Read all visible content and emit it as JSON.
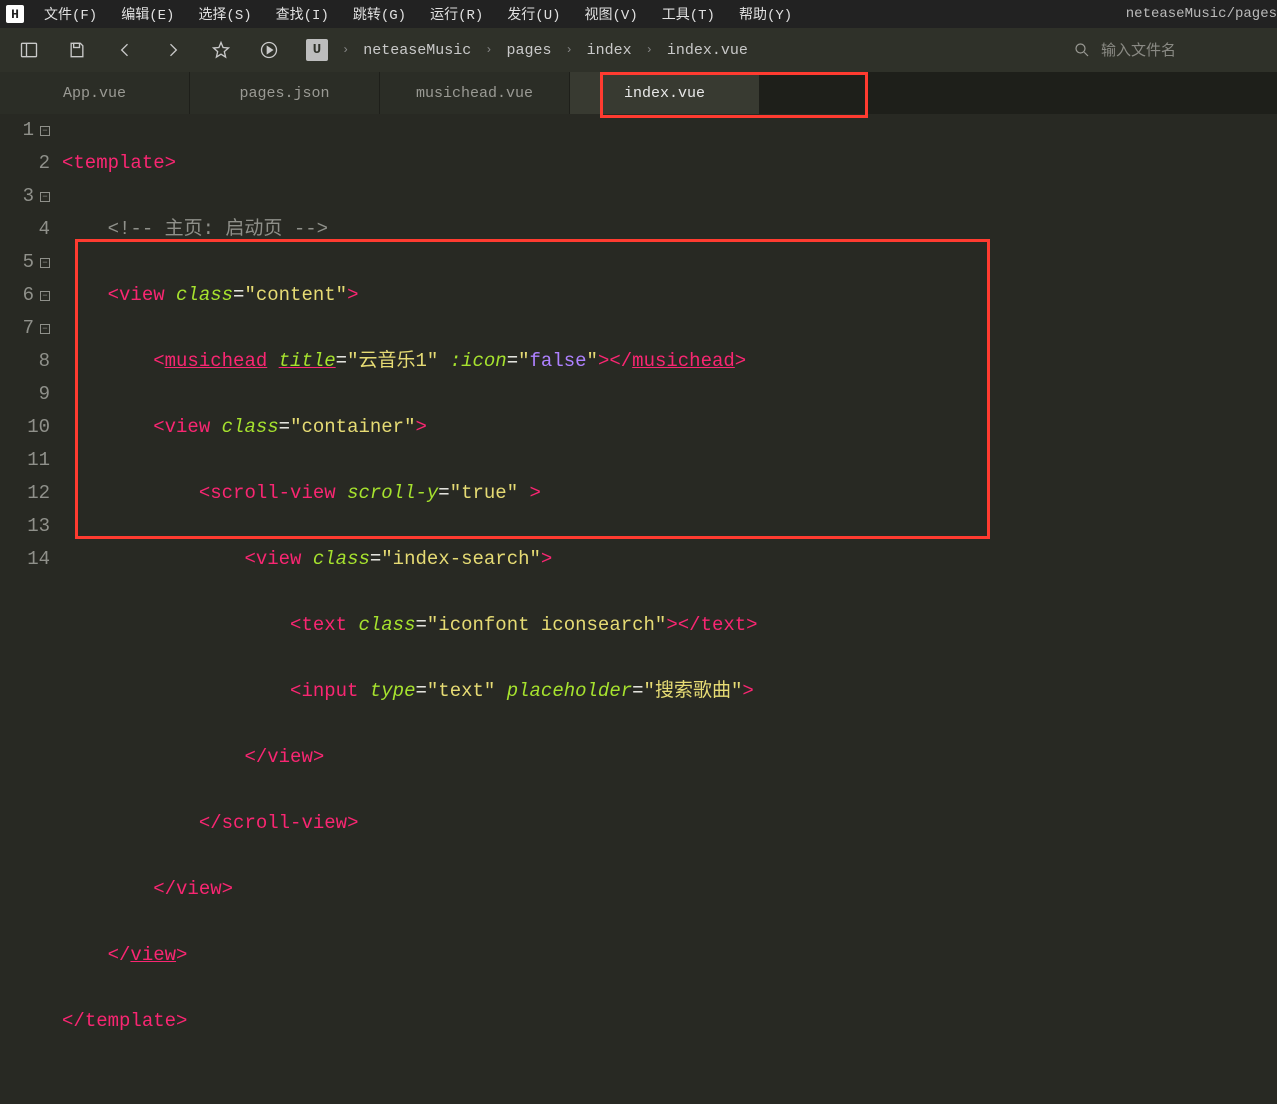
{
  "menu": {
    "logo": "H",
    "items": [
      "文件(F)",
      "编辑(E)",
      "选择(S)",
      "查找(I)",
      "跳转(G)",
      "运行(R)",
      "发行(U)",
      "视图(V)",
      "工具(T)",
      "帮助(Y)"
    ],
    "project_path": "neteaseMusic/pages"
  },
  "toolbar": {
    "project_icon": "U",
    "breadcrumb": [
      "neteaseMusic",
      "pages",
      "index",
      "index.vue"
    ],
    "search_placeholder": "输入文件名"
  },
  "tabs": [
    {
      "label": "App.vue",
      "active": false
    },
    {
      "label": "pages.json",
      "active": false
    },
    {
      "label": "musichead.vue",
      "active": false
    },
    {
      "label": "index.vue",
      "active": true
    }
  ],
  "editor": {
    "gutter": [
      "1",
      "2",
      "3",
      "4",
      "5",
      "6",
      "7",
      "8",
      "9",
      "10",
      "11",
      "12",
      "13",
      "14"
    ],
    "line1": {
      "open": "<",
      "tag": "template",
      "close": ">"
    },
    "line2": {
      "text": "<!-- 主页: 启动页 -->"
    },
    "line3": {
      "open": "<",
      "tag": "view",
      "attr": "class",
      "val": "\"content\"",
      "close": ">"
    },
    "line4": {
      "open": "<",
      "tag": "musichead",
      "a1": "title",
      "v1": "\"云音乐1\"",
      "a2": ":icon",
      "v2_pre": "\"",
      "v2_bool": "false",
      "v2_post": "\"",
      "mid": "></",
      "tag2": "musichead",
      "close": ">"
    },
    "line5": {
      "open": "<",
      "tag": "view",
      "attr": "class",
      "val": "\"container\"",
      "close": ">"
    },
    "line6": {
      "open": "<",
      "tag": "scroll-view",
      "attr": "scroll-y",
      "val": "\"true\"",
      "close": " >"
    },
    "line7": {
      "open": "<",
      "tag": "view",
      "attr": "class",
      "val": "\"index-search\"",
      "close": ">"
    },
    "line8": {
      "open": "<",
      "tag": "text",
      "attr": "class",
      "val": "\"iconfont iconsearch\"",
      "mid": "></",
      "tag2": "text",
      "close": ">"
    },
    "line9": {
      "open": "<",
      "tag": "input",
      "a1": "type",
      "v1": "\"text\"",
      "a2": "placeholder",
      "v2": "\"搜索歌曲\"",
      "close": ">"
    },
    "line10": {
      "open": "</",
      "tag": "view",
      "close": ">"
    },
    "line11": {
      "open": "</",
      "tag": "scroll-view",
      "close": ">"
    },
    "line12": {
      "open": "</",
      "tag": "view",
      "close": ">"
    },
    "line13": {
      "open": "</",
      "tag": "view",
      "close": ">"
    },
    "line14": {
      "open": "</",
      "tag": "template",
      "close": ">"
    }
  }
}
